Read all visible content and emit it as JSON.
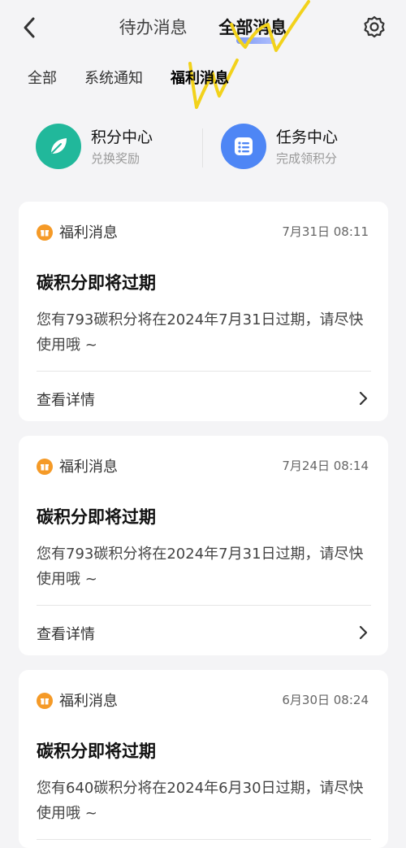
{
  "header": {
    "tabs": [
      {
        "label": "待办消息"
      },
      {
        "label": "全部消息"
      }
    ]
  },
  "subtabs": [
    {
      "label": "全部"
    },
    {
      "label": "系统通知"
    },
    {
      "label": "福利消息"
    }
  ],
  "quick_entries": [
    {
      "title": "积分中心",
      "subtitle": "兑换奖励",
      "icon": "leaf-icon",
      "color": "#21b89b"
    },
    {
      "title": "任务中心",
      "subtitle": "完成领积分",
      "icon": "task-list-icon",
      "color": "#4e86f5"
    }
  ],
  "cards": [
    {
      "category": "福利消息",
      "time": "7月31日 08:11",
      "title": "碳积分即将过期",
      "text": "您有793碳积分将在2024年7月31日过期，请尽快使用哦 ~",
      "action": "查看详情"
    },
    {
      "category": "福利消息",
      "time": "7月24日 08:14",
      "title": "碳积分即将过期",
      "text": "您有793碳积分将在2024年7月31日过期，请尽快使用哦 ~",
      "action": "查看详情"
    },
    {
      "category": "福利消息",
      "time": "6月30日 08:24",
      "title": "碳积分即将过期",
      "text": "您有640碳积分将在2024年6月30日过期，请尽快使用哦 ~",
      "action": "查看详情"
    }
  ],
  "colors": {
    "background": "#f4f4f6",
    "gift": "#f59a27",
    "scribble": "#f2d21b"
  }
}
